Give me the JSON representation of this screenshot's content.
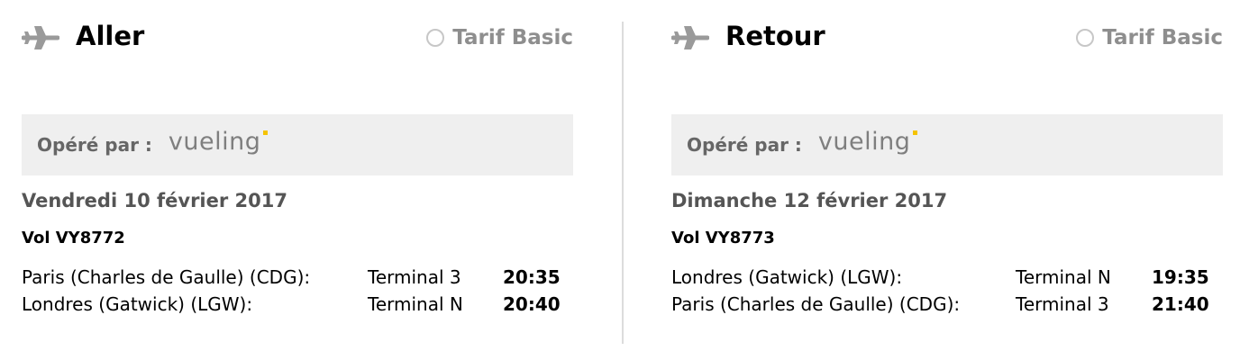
{
  "outbound": {
    "title": "Aller",
    "tarif_label": "Tarif Basic",
    "operated_by_label": "Opéré par :",
    "operator_logo": "vueling",
    "date": "Vendredi 10 février 2017",
    "flight": "Vol VY8772",
    "legs": [
      {
        "place": "Paris (Charles de Gaulle) (CDG):",
        "terminal": "Terminal 3",
        "time": "20:35"
      },
      {
        "place": "Londres (Gatwick) (LGW):",
        "terminal": "Terminal N",
        "time": "20:40"
      }
    ]
  },
  "return": {
    "title": "Retour",
    "tarif_label": "Tarif Basic",
    "operated_by_label": "Opéré par :",
    "operator_logo": "vueling",
    "date": "Dimanche 12 février 2017",
    "flight": "Vol VY8773",
    "legs": [
      {
        "place": "Londres (Gatwick) (LGW):",
        "terminal": "Terminal N",
        "time": "19:35"
      },
      {
        "place": "Paris (Charles de Gaulle) (CDG):",
        "terminal": "Terminal 3",
        "time": "21:40"
      }
    ]
  },
  "icons": {
    "plane": "airplane-icon",
    "radio": "radio-unchecked"
  },
  "colors": {
    "operator_dot": "#f5c300",
    "operated_bg": "#efefef",
    "muted_text": "#8e8e8e"
  }
}
